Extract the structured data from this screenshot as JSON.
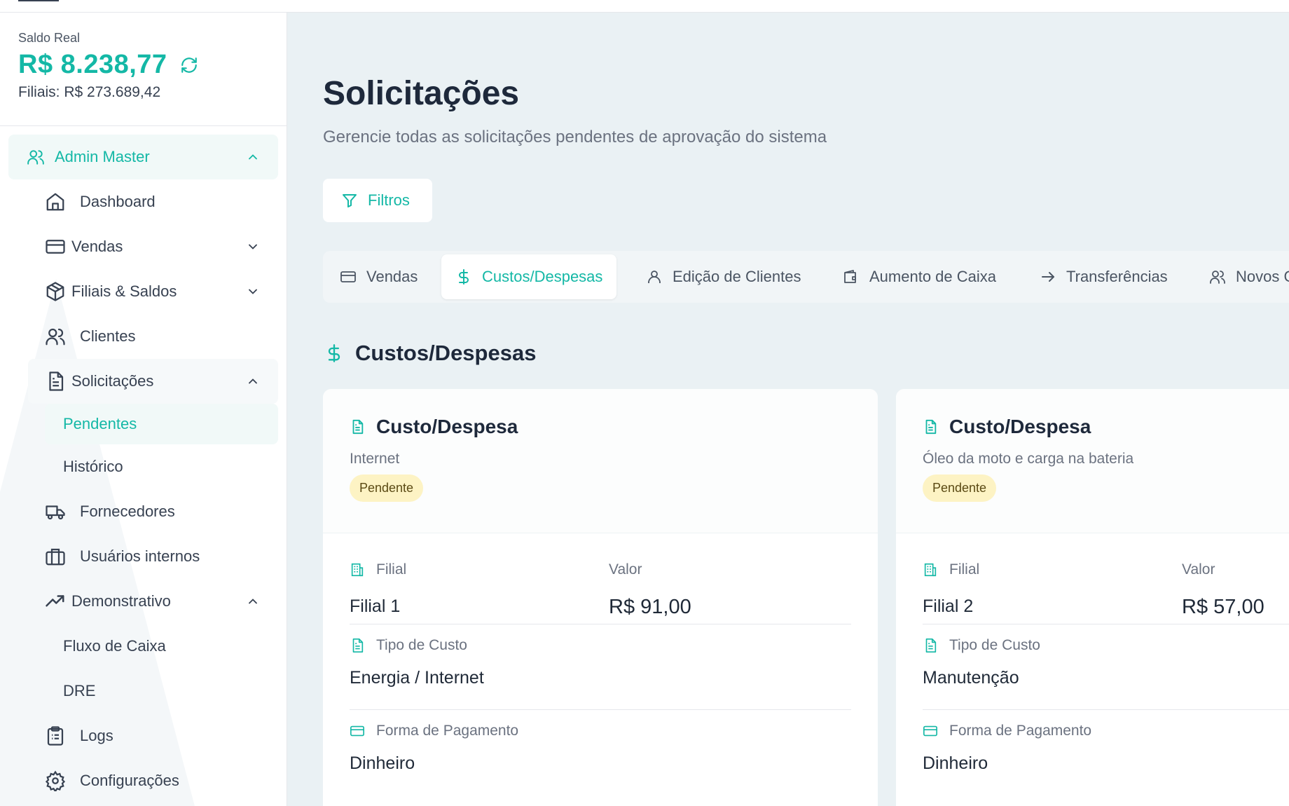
{
  "balance": {
    "label": "Saldo Real",
    "value": "R$ 8.238,77",
    "branches": "Filiais: R$ 273.689,42"
  },
  "sidebar": {
    "group": "Admin Master",
    "items": [
      {
        "label": "Dashboard",
        "icon": "home-icon"
      },
      {
        "label": "Vendas",
        "icon": "credit-card-icon"
      },
      {
        "label": "Filiais & Saldos",
        "icon": "package-icon"
      },
      {
        "label": "Clientes",
        "icon": "users-icon"
      },
      {
        "label": "Solicitações",
        "icon": "file-text-icon"
      },
      {
        "label": "Fornecedores",
        "icon": "truck-icon"
      },
      {
        "label": "Usuários internos",
        "icon": "briefcase-icon"
      },
      {
        "label": "Demonstrativo",
        "icon": "trending-up-icon"
      },
      {
        "label": "Logs",
        "icon": "clipboard-icon"
      },
      {
        "label": "Configurações",
        "icon": "gear-icon"
      }
    ],
    "solicitacoes_sub": [
      "Pendentes",
      "Histórico"
    ],
    "demonstrativo_sub": [
      "Fluxo de Caixa",
      "DRE"
    ]
  },
  "page": {
    "title": "Solicitações",
    "subtitle": "Gerencie todas as solicitações pendentes de aprovação do sistema",
    "filter_label": "Filtros"
  },
  "tabs": [
    {
      "label": "Vendas"
    },
    {
      "label": "Custos/Despesas"
    },
    {
      "label": "Edição de Clientes"
    },
    {
      "label": "Aumento de Caixa"
    },
    {
      "label": "Transferências"
    },
    {
      "label": "Novos Clientes"
    }
  ],
  "section": {
    "title": "Custos/Despesas"
  },
  "labels": {
    "filial": "Filial",
    "valor": "Valor",
    "tipo": "Tipo de Custo",
    "forma": "Forma de Pagamento"
  },
  "cards": [
    {
      "title": "Custo/Despesa",
      "description": "Internet",
      "status": "Pendente",
      "filial": "Filial 1",
      "valor": "R$ 91,00",
      "tipo": "Energia / Internet",
      "forma": "Dinheiro"
    },
    {
      "title": "Custo/Despesa",
      "description": "Óleo da moto e carga na bateria",
      "status": "Pendente",
      "filial": "Filial 2",
      "valor": "R$ 57,00",
      "tipo": "Manutenção",
      "forma": "Dinheiro"
    }
  ],
  "colors": {
    "accent": "#14b8a6",
    "pending_bg": "#fdf3c4",
    "page_bg": "#eaf1f4"
  }
}
